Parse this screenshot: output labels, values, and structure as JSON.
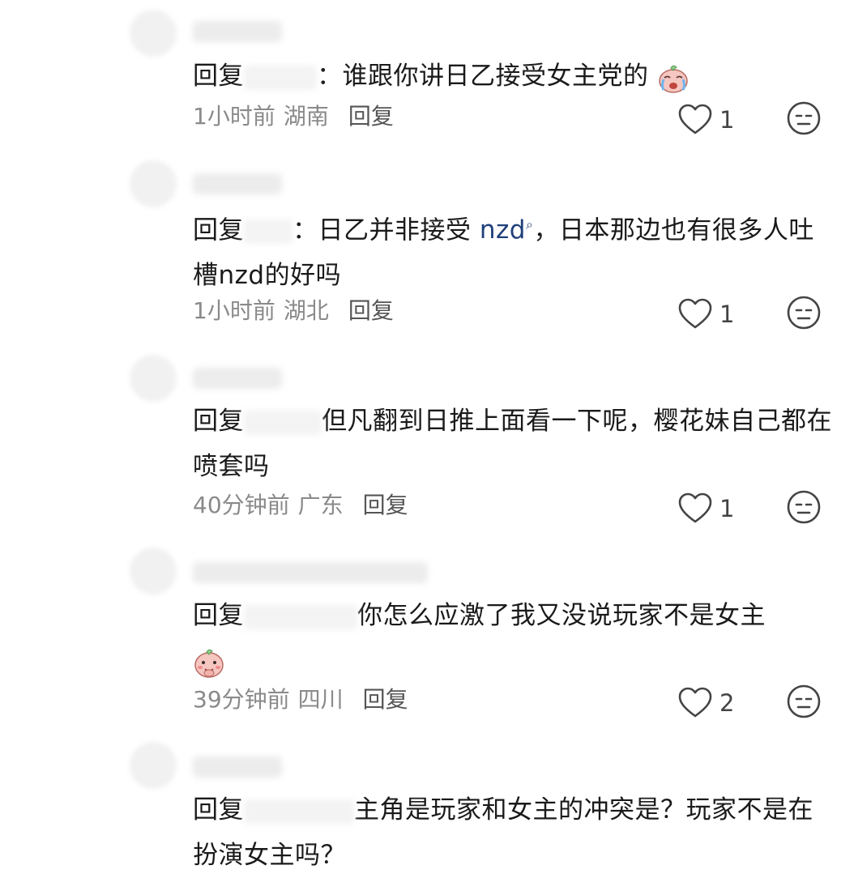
{
  "colors": {
    "text": "#1a1a1a",
    "meta": "#8a8a8a",
    "link": "#1f3f7a",
    "icon": "#444444"
  },
  "comments": [
    {
      "reply_prefix": "回复",
      "text": "：谁跟你讲日乙接受女主党的",
      "emoji": "crying-peach-emoji",
      "time": "1小时前",
      "location": "湖南",
      "reply_label": "回复",
      "likes": "1"
    },
    {
      "reply_prefix": "回复",
      "text_before": "：日乙并非接受 ",
      "link": "nzd",
      "link_icon": "search-icon",
      "text_after": "，日本那边也有很多人吐槽nzd的好吗",
      "time": "1小时前",
      "location": "湖北",
      "reply_label": "回复",
      "likes": "1"
    },
    {
      "reply_prefix": "回复",
      "text": "但凡翻到日推上面看一下呢，樱花妹自己都在喷套吗",
      "time": "40分钟前",
      "location": "广东",
      "reply_label": "回复",
      "likes": "1"
    },
    {
      "reply_prefix": "回复",
      "text": "你怎么应激了我又没说玩家不是女主",
      "emoji": "shy-peach-emoji",
      "time": "39分钟前",
      "location": "四川",
      "reply_label": "回复",
      "likes": "2"
    },
    {
      "reply_prefix": "回复",
      "text": "主角是玩家和女主的冲突是？玩家不是在扮演女主吗？"
    }
  ]
}
